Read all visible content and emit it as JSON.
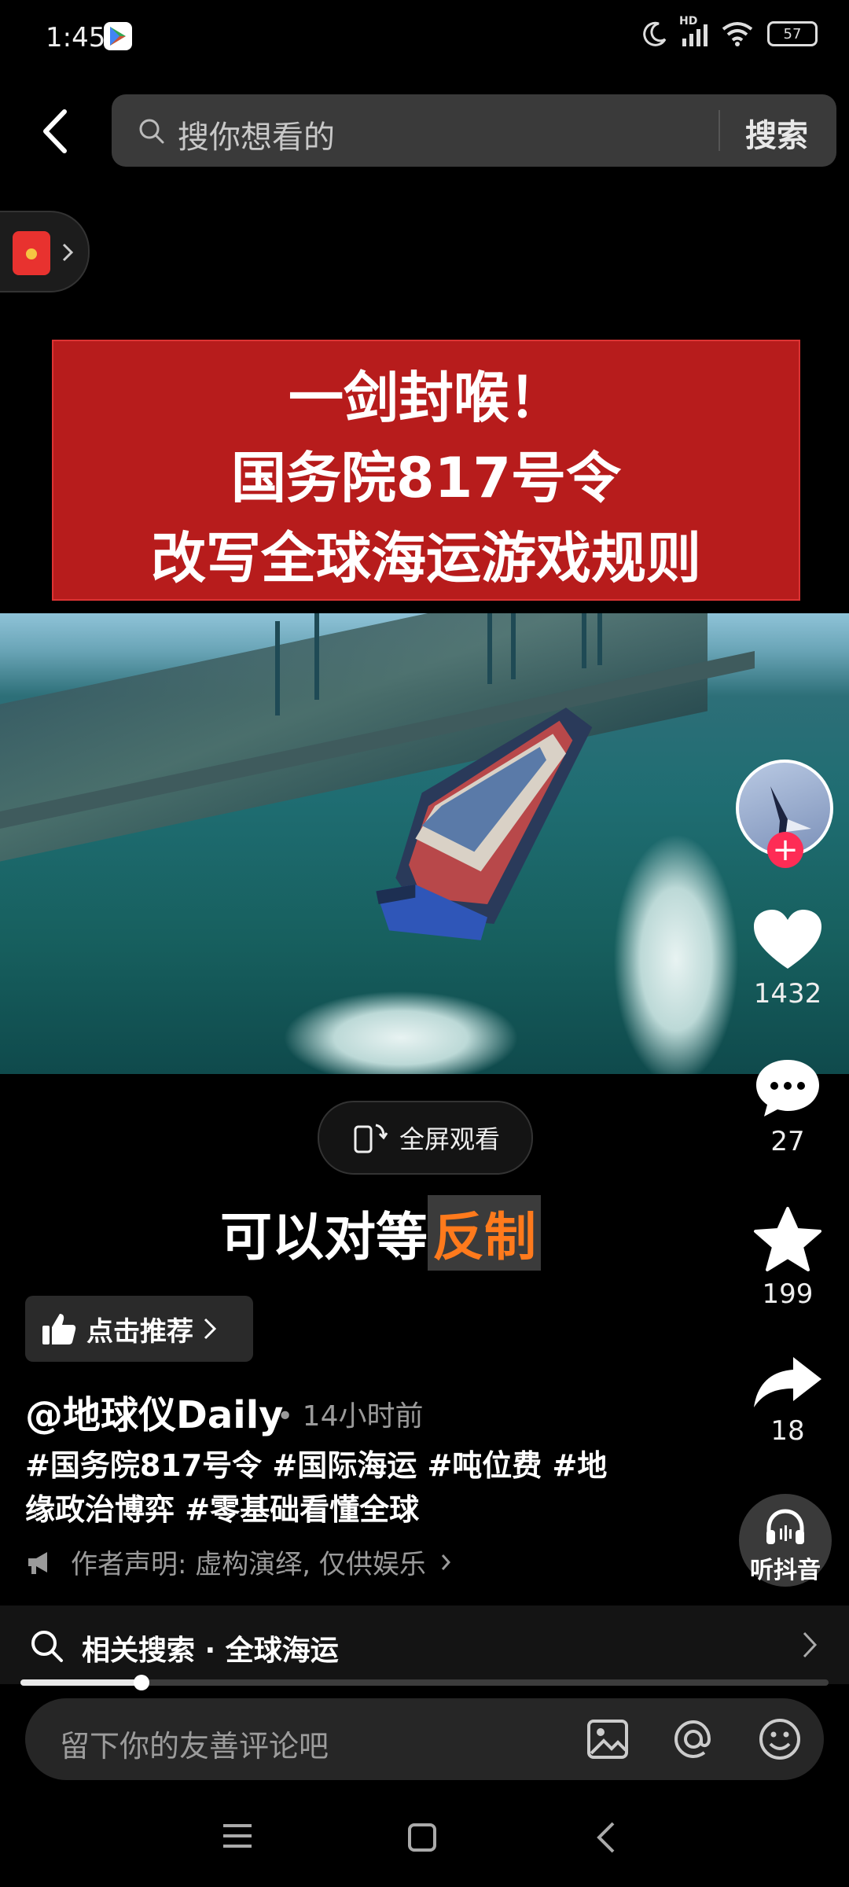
{
  "status_bar": {
    "time": "1:45",
    "hd": "HD",
    "battery": "57"
  },
  "search": {
    "placeholder": "搜你想看的",
    "button": "搜索"
  },
  "headline": {
    "line1": "一剑封喉！",
    "line2": "国务院817号令",
    "line3": "改写全球海运游戏规则"
  },
  "video": {
    "fullscreen_label": "全屏观看",
    "caption_plain": "可以对等",
    "caption_highlight": "反制"
  },
  "recommend_label": "点击推荐",
  "author": {
    "name": "@地球仪Daily",
    "time": "• 14小时前"
  },
  "tags": {
    "line1": "#国务院817号令 #国际海运 #吨位费 #地",
    "line2": "缘政治博弈 #零基础看懂全球"
  },
  "disclaimer": "作者声明: 虚构演绎, 仅供娱乐",
  "actions": {
    "likes": "1432",
    "comments": "27",
    "favorites": "199",
    "shares": "18",
    "listen_label": "听抖音"
  },
  "related_search": "相关搜索 · 全球海运",
  "progress": 0.15,
  "comment_placeholder": "留下你的友善评论吧",
  "colors": {
    "headline_red": "#b71c1c",
    "caption_highlight": "#ff7a1c",
    "follow_pink": "#fe2c55"
  }
}
